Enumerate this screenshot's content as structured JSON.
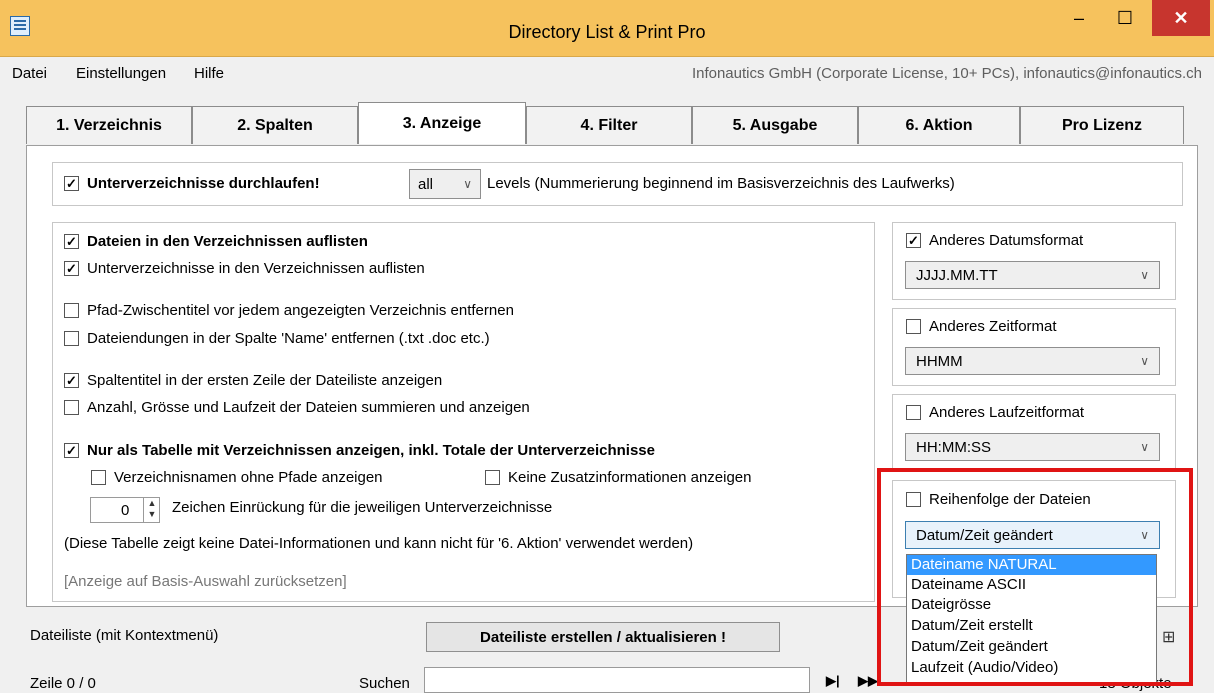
{
  "window": {
    "title": "Directory List & Print Pro",
    "minimize_glyph": "–",
    "maximize_glyph": "☐",
    "close_glyph": "✕"
  },
  "menu": {
    "items": [
      "Datei",
      "Einstellungen",
      "Hilfe"
    ],
    "license": "Infonautics GmbH (Corporate License, 10+ PCs), infonautics@infonautics.ch"
  },
  "tabs": [
    "1. Verzeichnis",
    "2. Spalten",
    "3. Anzeige",
    "4. Filter",
    "5. Ausgabe",
    "6. Aktion",
    "Pro Lizenz"
  ],
  "subdirs": {
    "label": "Unterverzeichnisse durchlaufen!",
    "checked": true,
    "levels_value": "all",
    "levels_text": "Levels  (Nummerierung beginnend im Basisverzeichnis des Laufwerks)"
  },
  "options": {
    "list_files": "Dateien in den Verzeichnissen auflisten",
    "list_subdirs": "Unterverzeichnisse in den Verzeichnissen auflisten",
    "remove_path_titles": "Pfad-Zwischentitel vor jedem angezeigten Verzeichnis entfernen",
    "remove_extensions": "Dateiendungen in der Spalte 'Name' entfernen (.txt .doc etc.)",
    "column_titles": "Spaltentitel in der ersten Zeile der Dateiliste anzeigen",
    "summarize": "Anzahl, Grösse und Laufzeit der Dateien summieren und anzeigen",
    "table_only": "Nur als Tabelle mit Verzeichnissen anzeigen, inkl. Totale der Unterverzeichnisse",
    "no_paths": "Verzeichnisnamen ohne Pfade anzeigen",
    "no_extra": "Keine Zusatzinformationen anzeigen",
    "indent_value": "0",
    "indent_label": "Zeichen Einrückung für die jeweiligen Unterverzeichnisse",
    "note": "(Diese Tabelle zeigt keine Datei-Informationen und kann nicht für '6. Aktion' verwendet werden)",
    "reset": "[Anzeige auf Basis-Auswahl zurücksetzen]"
  },
  "formats": {
    "date_label": "Anderes Datumsformat",
    "date_value": "JJJJ.MM.TT",
    "time_label": "Anderes Zeitformat",
    "time_value": "HHMM",
    "duration_label": "Anderes Laufzeitformat",
    "duration_value": "HH:MM:SS",
    "order_label": "Reihenfolge der Dateien",
    "order_value": "Datum/Zeit geändert",
    "order_options": [
      "Dateiname NATURAL",
      "Dateiname ASCII",
      "Dateigrösse",
      "Datum/Zeit erstellt",
      "Datum/Zeit geändert",
      "Laufzeit (Audio/Video)"
    ]
  },
  "bottom": {
    "list_label": "Dateiliste (mit Kontextmenü)",
    "create_button": "Dateiliste erstellen / aktualisieren !",
    "row_label": "Zeile 0 / 0",
    "search_label": "Suchen",
    "objects": "18 Objekte"
  },
  "colors": {
    "titlebar": "#f6c25d",
    "close": "#c7352e",
    "highlight": "#e01414",
    "selection": "#3399ff"
  }
}
